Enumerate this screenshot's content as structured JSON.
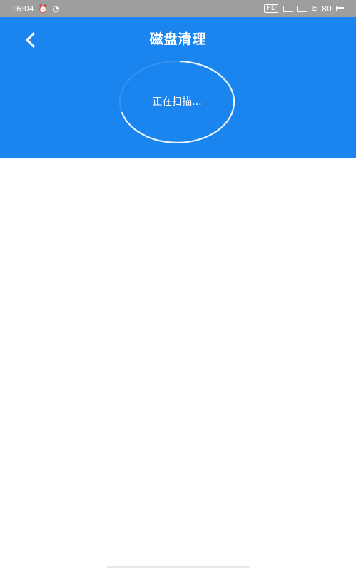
{
  "status_bar": {
    "time": "16:04",
    "left_icons": [
      "alarm-icon",
      "wifi-icon"
    ],
    "right_icons": [
      "hd-icon",
      "signal-icon",
      "signal-icon",
      "wifi-icon",
      "battery-icon"
    ],
    "hd_label": "HD",
    "battery_text": "80",
    "bg_color": "#9e9e9e"
  },
  "header": {
    "title": "磁盘清理",
    "back_icon": "chevron-left-icon",
    "bg_color": "#1a85ef"
  },
  "scan": {
    "status_text": "正在扫描..."
  }
}
